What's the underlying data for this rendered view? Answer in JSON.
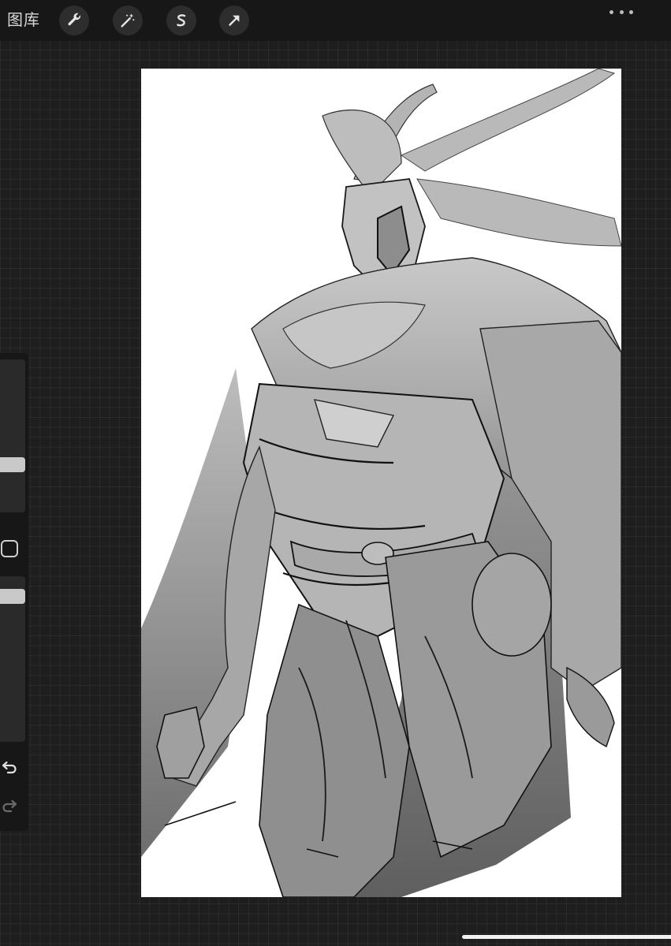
{
  "toolbar": {
    "gallery_label": "图库",
    "tools": [
      {
        "name": "actions",
        "icon": "wrench-icon"
      },
      {
        "name": "adjustments",
        "icon": "magic-wand-icon"
      },
      {
        "name": "selection",
        "icon": "selection-s-icon"
      },
      {
        "name": "transform",
        "icon": "arrow-cursor-icon"
      }
    ],
    "more_icon": "more-dots-icon"
  },
  "sidebar": {
    "brush_size_level": 0.15,
    "opacity_level": 0.05,
    "modify_icon": "square-modify-icon",
    "undo_icon": "undo-icon",
    "redo_icon": "redo-icon"
  },
  "canvas": {
    "content": "sketch-artwork",
    "background": "#ffffff"
  },
  "colors": {
    "toolbar_bg": "#171717",
    "workspace_bg": "#1e1e1e",
    "button_bg": "#2d2d2d",
    "icon_color": "#e6e6e6",
    "slider_thumb": "#c9c9c9"
  }
}
